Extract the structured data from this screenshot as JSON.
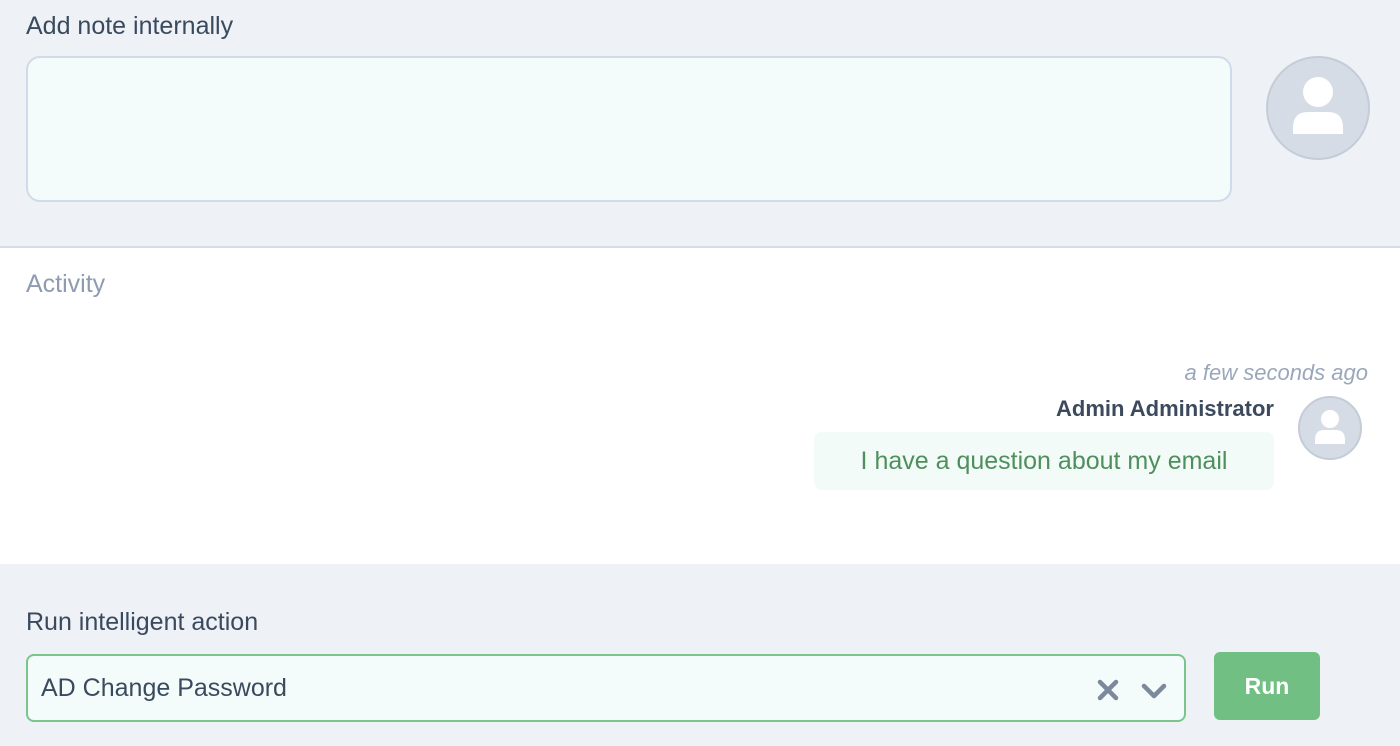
{
  "note": {
    "label": "Add note internally",
    "value": "",
    "avatar_icon": "user-icon"
  },
  "activity": {
    "title": "Activity",
    "items": [
      {
        "time": "a few seconds ago",
        "author": "Admin Administrator",
        "message": "I have a question about my email",
        "avatar_icon": "user-icon"
      }
    ]
  },
  "action": {
    "label": "Run intelligent action",
    "selected": "AD Change Password",
    "clear_icon": "close-icon",
    "dropdown_icon": "chevron-down-icon",
    "run_label": "Run"
  },
  "colors": {
    "page_background": "#eef1f6",
    "input_background": "#f4fcfb",
    "accent_green": "#72bf83",
    "message_text": "#4e8f5c",
    "avatar_fill": "#d6dce6"
  }
}
